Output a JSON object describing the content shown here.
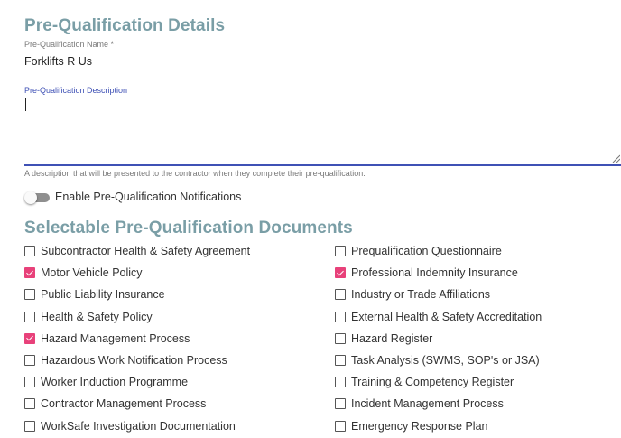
{
  "page": {
    "details_title": "Pre-Qualification Details",
    "documents_title": "Selectable Pre-Qualification Documents"
  },
  "form": {
    "name_label": "Pre-Qualification Name *",
    "name_value": "Forklifts R Us",
    "description_label": "Pre-Qualification Description",
    "description_value": "",
    "description_hint": "A description that will be presented to the contractor when they complete their pre-qualification.",
    "notifications_label": "Enable Pre-Qualification Notifications",
    "notifications_enabled": false
  },
  "documents": {
    "left": [
      {
        "label": "Subcontractor Health & Safety Agreement",
        "checked": false
      },
      {
        "label": "Motor Vehicle Policy",
        "checked": true
      },
      {
        "label": "Public Liability Insurance",
        "checked": false
      },
      {
        "label": "Health & Safety Policy",
        "checked": false
      },
      {
        "label": "Hazard Management Process",
        "checked": true
      },
      {
        "label": "Hazardous Work Notification Process",
        "checked": false
      },
      {
        "label": "Worker Induction Programme",
        "checked": false
      },
      {
        "label": "Contractor Management Process",
        "checked": false
      },
      {
        "label": "WorkSafe Investigation Documentation",
        "checked": false
      }
    ],
    "right": [
      {
        "label": "Prequalification Questionnaire",
        "checked": false
      },
      {
        "label": "Professional Indemnity Insurance",
        "checked": true
      },
      {
        "label": "Industry or Trade Affiliations",
        "checked": false
      },
      {
        "label": "External Health & Safety Accreditation",
        "checked": false
      },
      {
        "label": "Hazard Register",
        "checked": false
      },
      {
        "label": "Task Analysis (SWMS, SOP's or JSA)",
        "checked": false
      },
      {
        "label": "Training & Competency Register",
        "checked": false
      },
      {
        "label": "Incident Management Process",
        "checked": false
      },
      {
        "label": "Emergency Response Plan",
        "checked": false
      }
    ]
  },
  "colors": {
    "title": "#7a9ea6",
    "focus": "#3f51b5",
    "checkbox_checked": "#e8417a"
  }
}
